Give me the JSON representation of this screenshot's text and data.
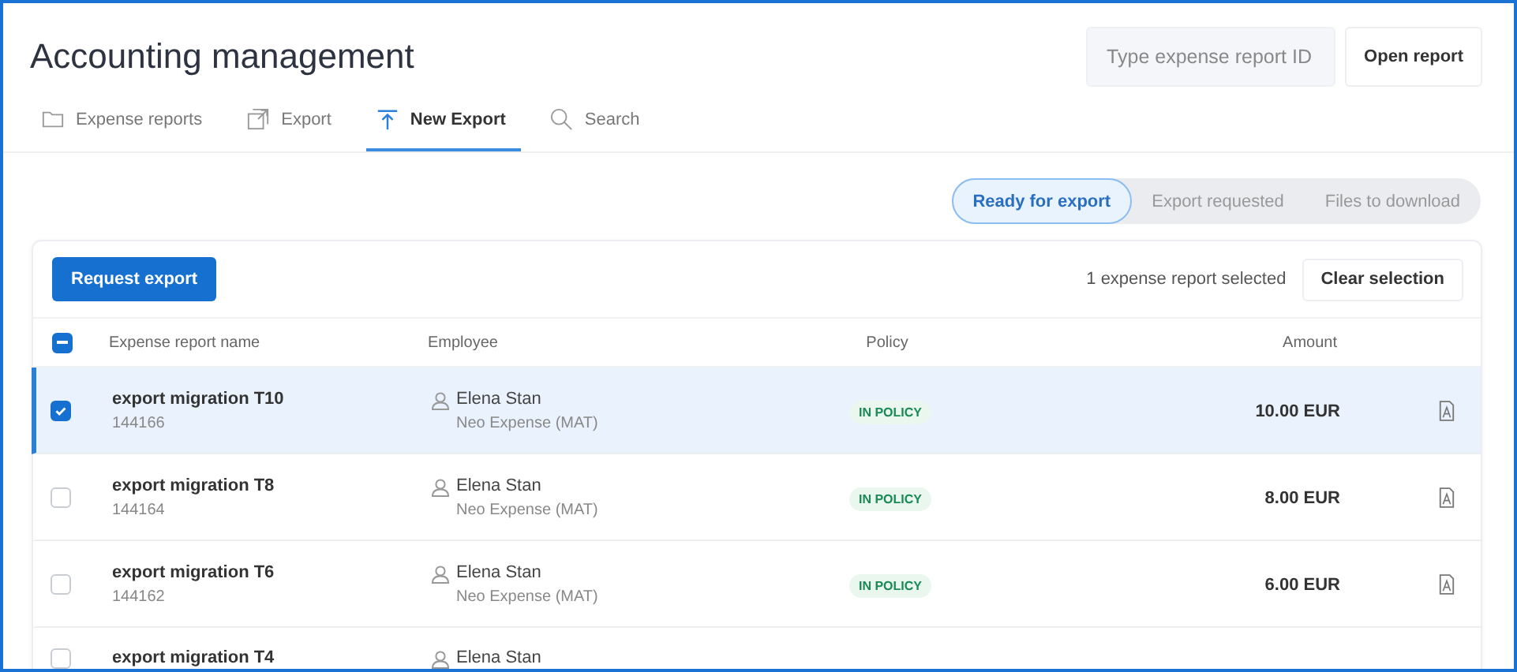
{
  "header": {
    "title": "Accounting management",
    "search": {
      "placeholder": "Type expense report ID"
    },
    "open_button": "Open report"
  },
  "tabs": [
    {
      "label": "Expense reports",
      "kind": "folder",
      "selected": false
    },
    {
      "label": "Export",
      "kind": "export",
      "selected": false
    },
    {
      "label": "New Export",
      "kind": "upload",
      "selected": true
    },
    {
      "label": "Search",
      "kind": "search",
      "selected": false
    }
  ],
  "segments": [
    {
      "label": "Ready for export",
      "selected": true
    },
    {
      "label": "Export requested",
      "selected": false
    },
    {
      "label": "Files to download",
      "selected": false
    }
  ],
  "toolbar": {
    "request_button": "Request export",
    "selection_text": "1 expense report selected",
    "clear_button": "Clear selection"
  },
  "table": {
    "select_all": {
      "indeterminate": true
    },
    "columns": [
      "Expense report name",
      "Employee",
      "Policy",
      "Amount"
    ],
    "rows": [
      {
        "name": "export migration T10",
        "id": "144166",
        "employee": "Elena Stan",
        "company": "Neo Expense (MAT)",
        "policy": "IN POLICY",
        "amount": "10.00 EUR",
        "selected": true
      },
      {
        "name": "export migration T8",
        "id": "144164",
        "employee": "Elena Stan",
        "company": "Neo Expense (MAT)",
        "policy": "IN POLICY",
        "amount": "8.00 EUR",
        "selected": false
      },
      {
        "name": "export migration T6",
        "id": "144162",
        "employee": "Elena Stan",
        "company": "Neo Expense (MAT)",
        "policy": "IN POLICY",
        "amount": "6.00 EUR",
        "selected": false
      },
      {
        "name": "export migration T4",
        "employee": "Elena Stan",
        "selected": false
      }
    ]
  }
}
